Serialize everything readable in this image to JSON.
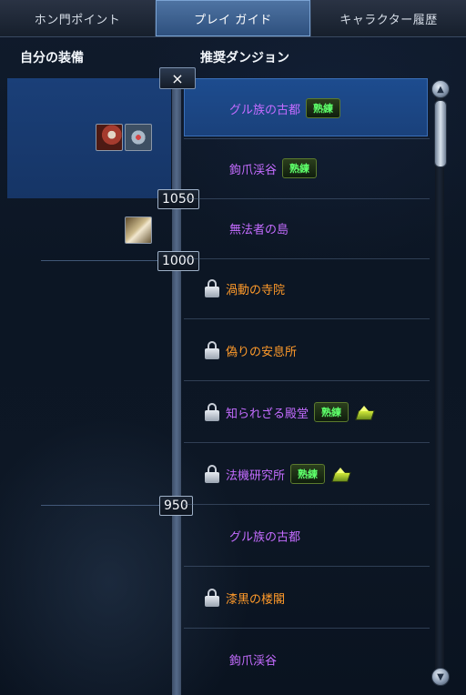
{
  "tabs": [
    {
      "label": "ホン門ポイント",
      "active": false
    },
    {
      "label": "プレイ ガイド",
      "active": true
    },
    {
      "label": "キャラクター履歴",
      "active": false
    }
  ],
  "headers": {
    "left": "自分の装備",
    "right": "推奨ダンジョン"
  },
  "close_icon": "×",
  "markers": [
    "1050",
    "1000",
    "950"
  ],
  "equipment_icons": [
    "red-weapon-icon",
    "steel-accessory-icon",
    "gold-glove-icon"
  ],
  "dungeons": [
    {
      "name": "グル族の古都",
      "color": "purple",
      "locked": false,
      "badge": "熟練",
      "gift": false,
      "selected": true
    },
    {
      "name": "鉤爪渓谷",
      "color": "purple",
      "locked": false,
      "badge": "熟練",
      "gift": false,
      "selected": false
    },
    {
      "name": "無法者の島",
      "color": "purple",
      "locked": false,
      "badge": "",
      "gift": false,
      "selected": false
    },
    {
      "name": "渦動の寺院",
      "color": "orange",
      "locked": true,
      "badge": "",
      "gift": false,
      "selected": false
    },
    {
      "name": "偽りの安息所",
      "color": "orange",
      "locked": true,
      "badge": "",
      "gift": false,
      "selected": false
    },
    {
      "name": "知られざる殿堂",
      "color": "purple",
      "locked": true,
      "badge": "熟練",
      "gift": true,
      "selected": false
    },
    {
      "name": "法機研究所",
      "color": "purple",
      "locked": true,
      "badge": "熟練",
      "gift": true,
      "selected": false
    },
    {
      "name": "グル族の古都",
      "color": "purple",
      "locked": false,
      "badge": "",
      "gift": false,
      "selected": false
    },
    {
      "name": "漆黒の楼閣",
      "color": "orange",
      "locked": true,
      "badge": "",
      "gift": false,
      "selected": false
    },
    {
      "name": "鉤爪渓谷",
      "color": "purple",
      "locked": false,
      "badge": "",
      "gift": false,
      "selected": false
    }
  ],
  "scrollbar": {
    "up_glyph": "▲",
    "down_glyph": "▼",
    "position": 0.0
  }
}
